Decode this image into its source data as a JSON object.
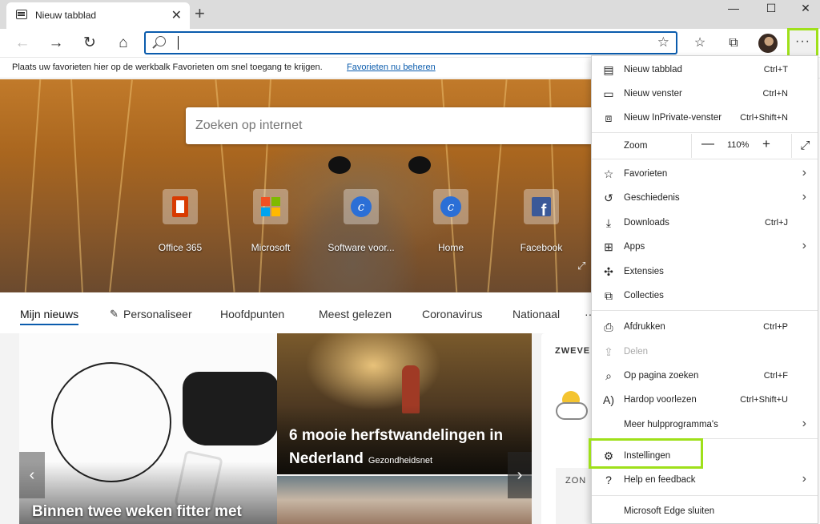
{
  "tab": {
    "title": "Nieuw tabblad",
    "close": "✕",
    "new": "+"
  },
  "window": {
    "minimize": "—",
    "maximize": "☐",
    "close": "✕"
  },
  "nav": {
    "back": "←",
    "forward": "→",
    "refresh": "↻",
    "home": "⌂",
    "more": "···",
    "favorites_icon": "☆",
    "collections_icon": "⧉",
    "address_value": "",
    "address_star": "☆"
  },
  "favbar": {
    "message": "Plaats uw favorieten hier op de werkbalk Favorieten om snel toegang te krijgen.",
    "link": "Favorieten nu beheren"
  },
  "hero": {
    "search_placeholder": "Zoeken op internet",
    "tiles": [
      {
        "label": "Office 365",
        "icon": "office-icon",
        "color": "#d83b01"
      },
      {
        "label": "Microsoft",
        "icon": "microsoft-logo-icon",
        "color": "#7fba00"
      },
      {
        "label": "Software voor...",
        "icon": "c-logo-icon",
        "color": "#2b6fd6"
      },
      {
        "label": "Home",
        "icon": "c-logo-icon",
        "color": "#2b6fd6"
      },
      {
        "label": "Facebook",
        "icon": "facebook-icon",
        "color": "#3b5998"
      }
    ],
    "expand": "⤢"
  },
  "news": {
    "tabs": [
      "Mijn nieuws",
      "Personaliseer",
      "Hoofdpunten",
      "Meest gelezen",
      "Coronavirus",
      "Nationaal",
      "···"
    ],
    "card1_headline": "Binnen twee weken fitter met",
    "card2_headline": "6 mooie herfstwandelingen in Nederland",
    "card2_source": "Gezondheidsnet",
    "weather_title": "ZWEVE",
    "weather_sub": "ZON",
    "prev": "‹",
    "next": "›"
  },
  "menu": {
    "items": [
      {
        "label": "Nieuw tabblad",
        "shortcut": "Ctrl+T",
        "icon": "new-tab-icon"
      },
      {
        "label": "Nieuw venster",
        "shortcut": "Ctrl+N",
        "icon": "new-window-icon"
      },
      {
        "label": "Nieuw InPrivate-venster",
        "shortcut": "Ctrl+Shift+N",
        "icon": "inprivate-icon"
      },
      {
        "label": "Zoom"
      },
      {
        "label": "Favorieten",
        "icon": "favorites-icon"
      },
      {
        "label": "Geschiedenis",
        "icon": "history-icon"
      },
      {
        "label": "Downloads",
        "shortcut": "Ctrl+J",
        "icon": "download-icon"
      },
      {
        "label": "Apps",
        "icon": "apps-icon"
      },
      {
        "label": "Extensies",
        "icon": "extensions-icon"
      },
      {
        "label": "Collecties",
        "icon": "collections-icon"
      },
      {
        "label": "Afdrukken",
        "shortcut": "Ctrl+P",
        "icon": "print-icon"
      },
      {
        "label": "Delen",
        "icon": "share-icon"
      },
      {
        "label": "Op pagina zoeken",
        "shortcut": "Ctrl+F",
        "icon": "find-icon"
      },
      {
        "label": "Hardop voorlezen",
        "shortcut": "Ctrl+Shift+U",
        "icon": "read-aloud-icon"
      },
      {
        "label": "Meer hulpprogramma's"
      },
      {
        "label": "Instellingen",
        "icon": "gear-icon"
      },
      {
        "label": "Help en feedback",
        "icon": "help-icon"
      },
      {
        "label": "Microsoft Edge sluiten"
      }
    ],
    "zoom": {
      "minus": "—",
      "value": "110%",
      "plus": "+",
      "fullscreen": "⤢"
    },
    "chevron": "›"
  },
  "colors": {
    "accent": "#0b5cad",
    "highlight": "#9fe01a"
  }
}
